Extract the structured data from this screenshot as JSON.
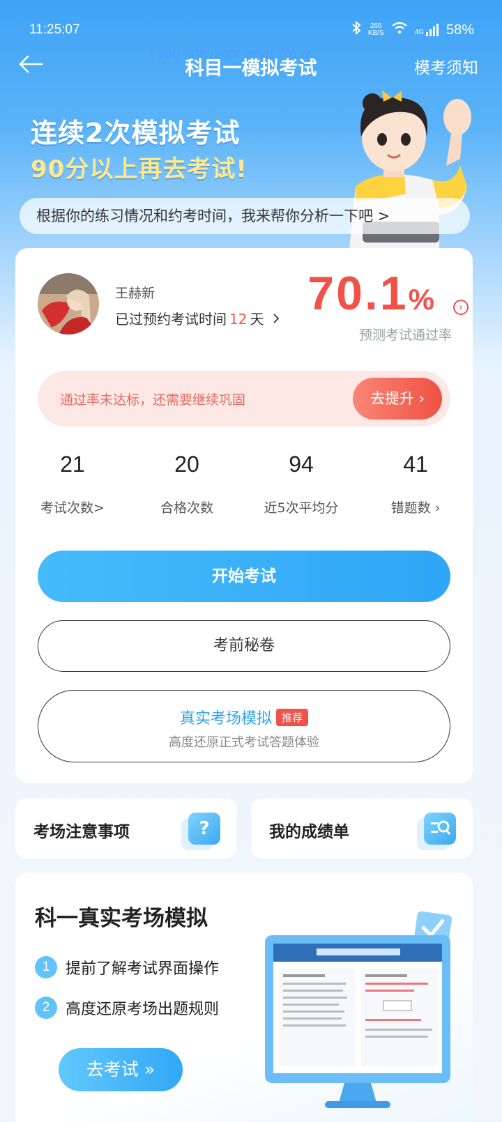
{
  "status_bar": {
    "time": "11:25:07",
    "net_speed_value": "265",
    "net_speed_unit": "KB/S",
    "signal": "4G",
    "battery": "58%"
  },
  "header": {
    "title": "科目一模拟考试",
    "right_link": "模考须知",
    "overlay_text": "t you late night what I'm w"
  },
  "banner": {
    "line1": "连续2次模拟考试",
    "line2": "90分以上再去考试!",
    "analysis": "根据你的练习情况和约考时间，我来帮你分析一下吧 >"
  },
  "profile": {
    "name": "王赫新",
    "exam_time_prefix": "已过预约考试时间",
    "exam_days": "12",
    "exam_time_suffix": "天",
    "pass_rate": "70.1",
    "pass_rate_unit": "%",
    "pass_rate_label": "预测考试通过率"
  },
  "warning": {
    "text": "通过率未达标，还需要继续巩固",
    "button": "去提升 ›"
  },
  "stats": [
    {
      "value": "21",
      "label": "考试次数>"
    },
    {
      "value": "20",
      "label": "合格次数"
    },
    {
      "value": "94",
      "label": "近5次平均分"
    },
    {
      "value": "41",
      "label": "错题数 ›"
    }
  ],
  "buttons": {
    "start": "开始考试",
    "secret": "考前秘卷",
    "real_title": "真实考场模拟",
    "real_badge": "推荐",
    "real_sub": "高度还原正式考试答题体验"
  },
  "mini_cards": {
    "notice": "考场注意事项",
    "notice_icon": "?",
    "scores": "我的成绩单"
  },
  "simulation": {
    "title": "科一真实考场模拟",
    "point1_num": "1",
    "point1": "提前了解考试界面操作",
    "point2_num": "2",
    "point2": "高度还原考场出题规则",
    "go_button": "去考试 »"
  },
  "colors": {
    "accent_blue": "#2fa6f6",
    "accent_red": "#f0524a",
    "banner_yellow": "#ffe98a"
  }
}
